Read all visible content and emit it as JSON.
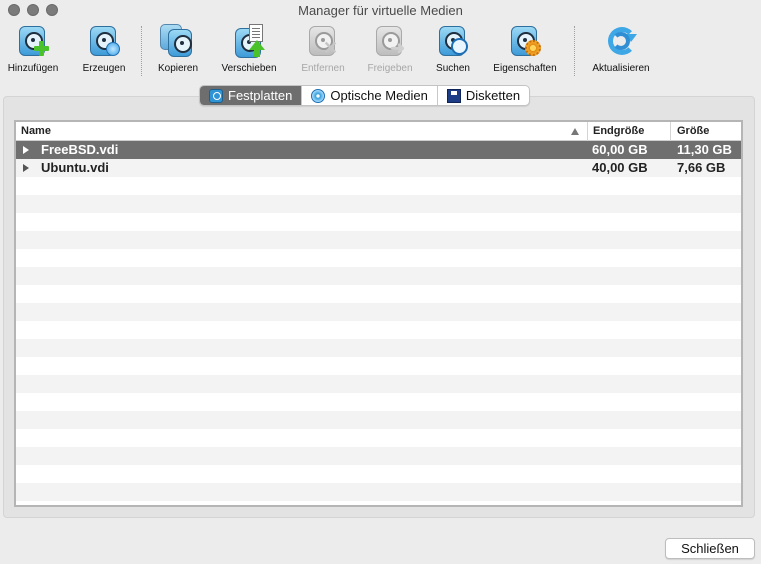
{
  "window": {
    "title": "Manager für virtuelle Medien"
  },
  "toolbar": {
    "add": "Hinzufügen",
    "create": "Erzeugen",
    "copy": "Kopieren",
    "move": "Verschieben",
    "remove": "Entfernen",
    "release": "Freigeben",
    "search": "Suchen",
    "properties": "Eigenschaften",
    "refresh": "Aktualisieren"
  },
  "tabs": {
    "hard_disks": "Festplatten",
    "optical": "Optische Medien",
    "floppy": "Disketten",
    "active": "hard_disks"
  },
  "table": {
    "columns": {
      "name": "Name",
      "virtual_size": "Endgröße",
      "actual_size": "Größe"
    },
    "rows": [
      {
        "name": "FreeBSD.vdi",
        "virtual_size": "60,00 GB",
        "actual_size": "11,30 GB",
        "selected": true
      },
      {
        "name": "Ubuntu.vdi",
        "virtual_size": "40,00 GB",
        "actual_size": "7,66 GB",
        "selected": false
      }
    ]
  },
  "footer": {
    "close": "Schließen"
  },
  "colors": {
    "selection": "#6f6f6f",
    "accent": "#3ea7e6",
    "add_green": "#4cc22a"
  }
}
